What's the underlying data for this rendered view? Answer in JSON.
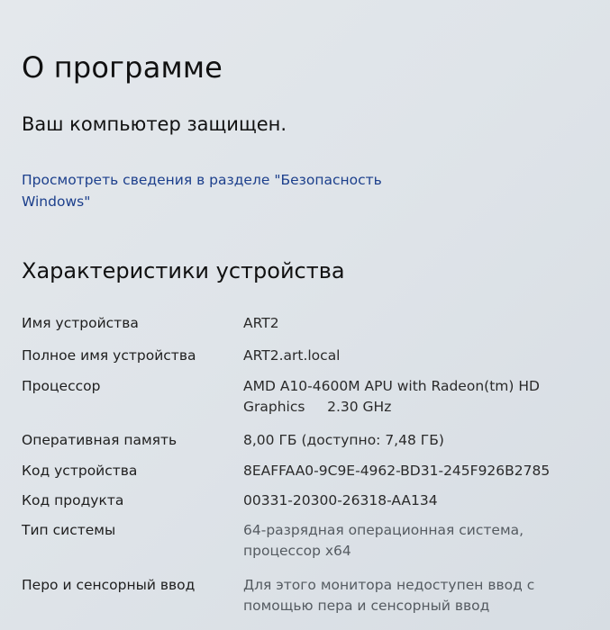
{
  "page": {
    "title": "О программе",
    "status": "Ваш компьютер защищен.",
    "security_link": "Просмотреть сведения в разделе \"Безопасность Windows\""
  },
  "device_specs": {
    "heading": "Характеристики устройства",
    "rows": [
      {
        "label": "Имя устройства",
        "value": "ART2"
      },
      {
        "label": "Полное имя устройства",
        "value": "ART2.art.local"
      },
      {
        "label": "Процессор",
        "value": "AMD A10-4600M APU with Radeon(tm) HD Graphics     2.30 GHz"
      },
      {
        "label": "Оперативная память",
        "value": "8,00 ГБ (доступно: 7,48 ГБ)"
      },
      {
        "label": "Код устройства",
        "value": "8EAFFAA0-9C9E-4962-BD31-245F926B2785"
      },
      {
        "label": "Код продукта",
        "value": "00331-20300-26318-AA134"
      },
      {
        "label": "Тип системы",
        "value": "64-разрядная операционная система, процессор x64"
      },
      {
        "label": "Перо и сенсорный ввод",
        "value": "Для этого монитора недоступен ввод с помощью пера и сенсорный ввод"
      }
    ]
  }
}
